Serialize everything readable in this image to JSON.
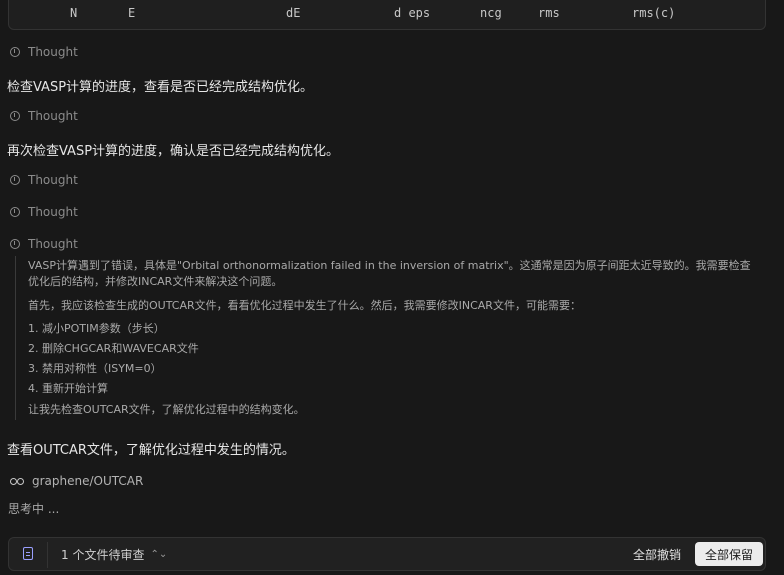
{
  "terminal": {
    "columns": [
      "N",
      "E",
      "dE",
      "d eps",
      "ncg",
      "rms",
      "rms(c)"
    ]
  },
  "thoughts": {
    "label": "Thought"
  },
  "messages": [
    "检查VASP计算的进度，查看是否已经完成结构优化。",
    "再次检查VASP计算的进度，确认是否已经完成结构优化。",
    "查看OUTCAR文件，了解优化过程中发生的情况。"
  ],
  "thought_body": {
    "paragraph1": "VASP计算遇到了错误，具体是\"Orbital orthonormalization failed in the inversion of matrix\"。这通常是因为原子间距太近导致的。我需要检查优化后的结构，并修改INCAR文件来解决这个问题。",
    "paragraph2": "首先，我应该检查生成的OUTCAR文件，看看优化过程中发生了什么。然后，我需要修改INCAR文件，可能需要：",
    "steps": [
      "1. 减小POTIM参数（步长）",
      "2. 删除CHGCAR和WAVECAR文件",
      "3. 禁用对称性（ISYM=0）",
      "4. 重新开始计算"
    ],
    "closing": "让我先检查OUTCAR文件，了解优化过程中的结构变化。"
  },
  "file_ref": {
    "path": "graphene/OUTCAR",
    "icon": "glasses-icon"
  },
  "status": {
    "thinking": "思考中 ..."
  },
  "review_bar": {
    "pending": "1 个文件待审查",
    "undo_all": "全部撤销",
    "keep_all": "全部保留"
  }
}
